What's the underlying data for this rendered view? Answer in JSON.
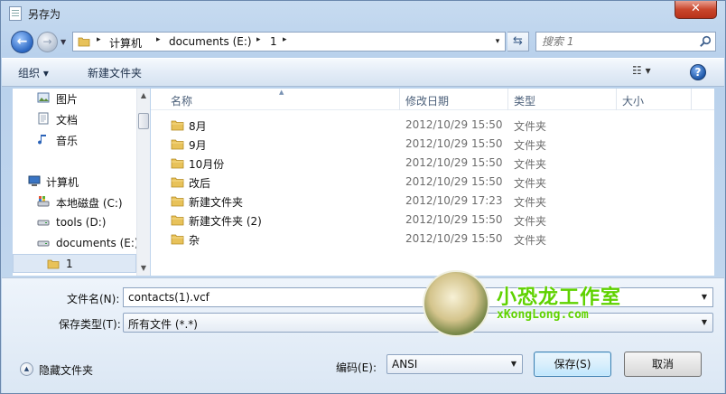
{
  "window": {
    "title": "另存为",
    "close_glyph": "✕"
  },
  "address_bar": {
    "breadcrumbs": [
      "计算机",
      "documents (E:)",
      "1"
    ],
    "separator_glyph": "▸",
    "dropdown_glyph": "▾"
  },
  "search": {
    "placeholder": "搜索 1",
    "icon": "search-icon"
  },
  "toolbar": {
    "organize_label": "组织 ▾",
    "new_folder_label": "新建文件夹",
    "view_glyph": "☷ ▾",
    "help_glyph": "?"
  },
  "navigation": {
    "items": [
      {
        "label": "图片",
        "icon": "pictures-icon"
      },
      {
        "label": "文档",
        "icon": "documents-icon"
      },
      {
        "label": "音乐",
        "icon": "music-icon"
      },
      {
        "label": "计算机",
        "icon": "computer-icon"
      },
      {
        "label": "本地磁盘 (C:)",
        "icon": "system-drive-icon"
      },
      {
        "label": "tools (D:)",
        "icon": "drive-icon"
      },
      {
        "label": "documents (E:)",
        "icon": "drive-icon"
      },
      {
        "label": "1",
        "icon": "folder-icon",
        "selected": true
      }
    ]
  },
  "file_list": {
    "columns": [
      "名称",
      "修改日期",
      "类型",
      "大小"
    ],
    "rows": [
      {
        "name": "8月",
        "date": "2012/10/29 15:50",
        "type": "文件夹"
      },
      {
        "name": "9月",
        "date": "2012/10/29 15:50",
        "type": "文件夹"
      },
      {
        "name": "10月份",
        "date": "2012/10/29 15:50",
        "type": "文件夹"
      },
      {
        "name": "改后",
        "date": "2012/10/29 15:50",
        "type": "文件夹"
      },
      {
        "name": "新建文件夹",
        "date": "2012/10/29 17:23",
        "type": "文件夹"
      },
      {
        "name": "新建文件夹 (2)",
        "date": "2012/10/29 15:50",
        "type": "文件夹"
      },
      {
        "name": "杂",
        "date": "2012/10/29 15:50",
        "type": "文件夹"
      }
    ]
  },
  "form": {
    "filename_label": "文件名(N):",
    "filename_value": "contacts(1).vcf",
    "filetype_label": "保存类型(T):",
    "filetype_value": "所有文件  (*.*)",
    "hide_folders_label": "隐藏文件夹",
    "encoding_label": "编码(E):",
    "encoding_value": "ANSI",
    "save_label": "保存(S)",
    "cancel_label": "取消"
  },
  "watermark": {
    "title": "小恐龙工作室",
    "url": "xKongLong.com"
  },
  "colors": {
    "accent": "#3c7fb1",
    "close": "#c9462c",
    "watermark": "#5fd200",
    "folder": "#e8c25a"
  }
}
